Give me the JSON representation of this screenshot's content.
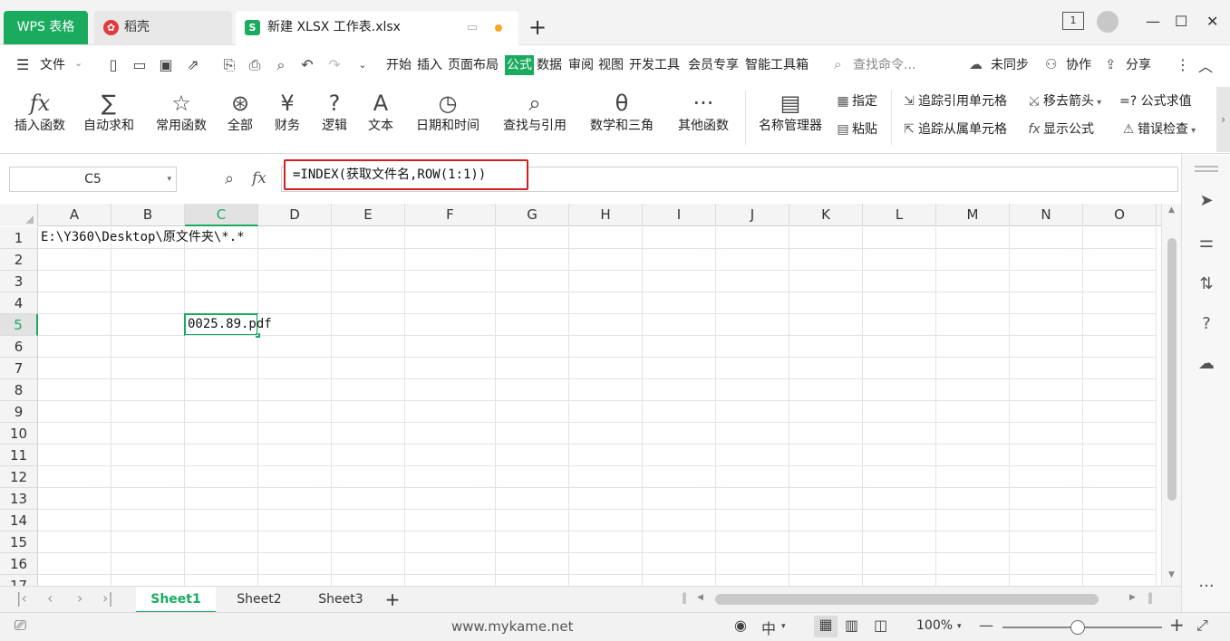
{
  "tabs": {
    "wps": "WPS 表格",
    "daoke": "稻壳",
    "doc": "新建 XLSX 工作表.xlsx",
    "add": "+"
  },
  "window": {
    "page_badge": "1",
    "minimize": "—",
    "maximize": "☐",
    "close": "✕"
  },
  "menu": {
    "file": "文件",
    "items": [
      "开始",
      "插入",
      "页面布局",
      "公式",
      "数据",
      "审阅",
      "视图",
      "开发工具",
      "会员专享",
      "智能工具箱"
    ],
    "active": "公式",
    "search_placeholder": "查找命令...",
    "sync": "未同步",
    "collab": "协作",
    "share": "分享"
  },
  "ribbon": {
    "buttons": [
      {
        "icon": "fx",
        "label": "插入函数"
      },
      {
        "icon": "∑",
        "label": "自动求和"
      },
      {
        "icon": "☆",
        "label": "常用函数"
      },
      {
        "icon": "⊛",
        "label": "全部"
      },
      {
        "icon": "¥",
        "label": "财务"
      },
      {
        "icon": "?",
        "label": "逻辑"
      },
      {
        "icon": "A",
        "label": "文本"
      },
      {
        "icon": "◷",
        "label": "日期和时间"
      },
      {
        "icon": "⌕",
        "label": "查找与引用"
      },
      {
        "icon": "θ",
        "label": "数学和三角"
      },
      {
        "icon": "···",
        "label": "其他函数"
      },
      {
        "icon": "▤",
        "label": "名称管理器"
      }
    ],
    "specify": "指定",
    "paste": "粘贴",
    "trace_precedents": "追踪引用单元格",
    "trace_dependents": "追踪从属单元格",
    "remove_arrows": "移去箭头",
    "show_formulas": "显示公式",
    "evaluate_formula": "=? 公式求值",
    "error_check": "错误检查"
  },
  "formula_bar": {
    "name_box": "C5",
    "fx": "fx",
    "formula": "=INDEX(获取文件名,ROW(1:1))"
  },
  "grid": {
    "columns": [
      "A",
      "B",
      "C",
      "D",
      "E",
      "F",
      "G",
      "H",
      "I",
      "J",
      "K",
      "L",
      "M",
      "N",
      "O"
    ],
    "rows": [
      "1",
      "2",
      "3",
      "4",
      "5",
      "6",
      "7",
      "8",
      "9",
      "10",
      "11",
      "12",
      "13",
      "14",
      "15",
      "16",
      "17"
    ],
    "active_column": "C",
    "active_row": "5",
    "cells": {
      "A1": "E:\\Y360\\Desktop\\原文件夹\\*.*",
      "C5": "0025.89.pdf"
    }
  },
  "sheets": {
    "tabs": [
      "Sheet1",
      "Sheet2",
      "Sheet3"
    ],
    "active": "Sheet1",
    "add": "+"
  },
  "status": {
    "watermark": "www.mykame.net",
    "zoom": "100%",
    "input_mode": "中"
  },
  "colors": {
    "accent": "#1aab5e",
    "highlight_border": "#d21f1f"
  }
}
